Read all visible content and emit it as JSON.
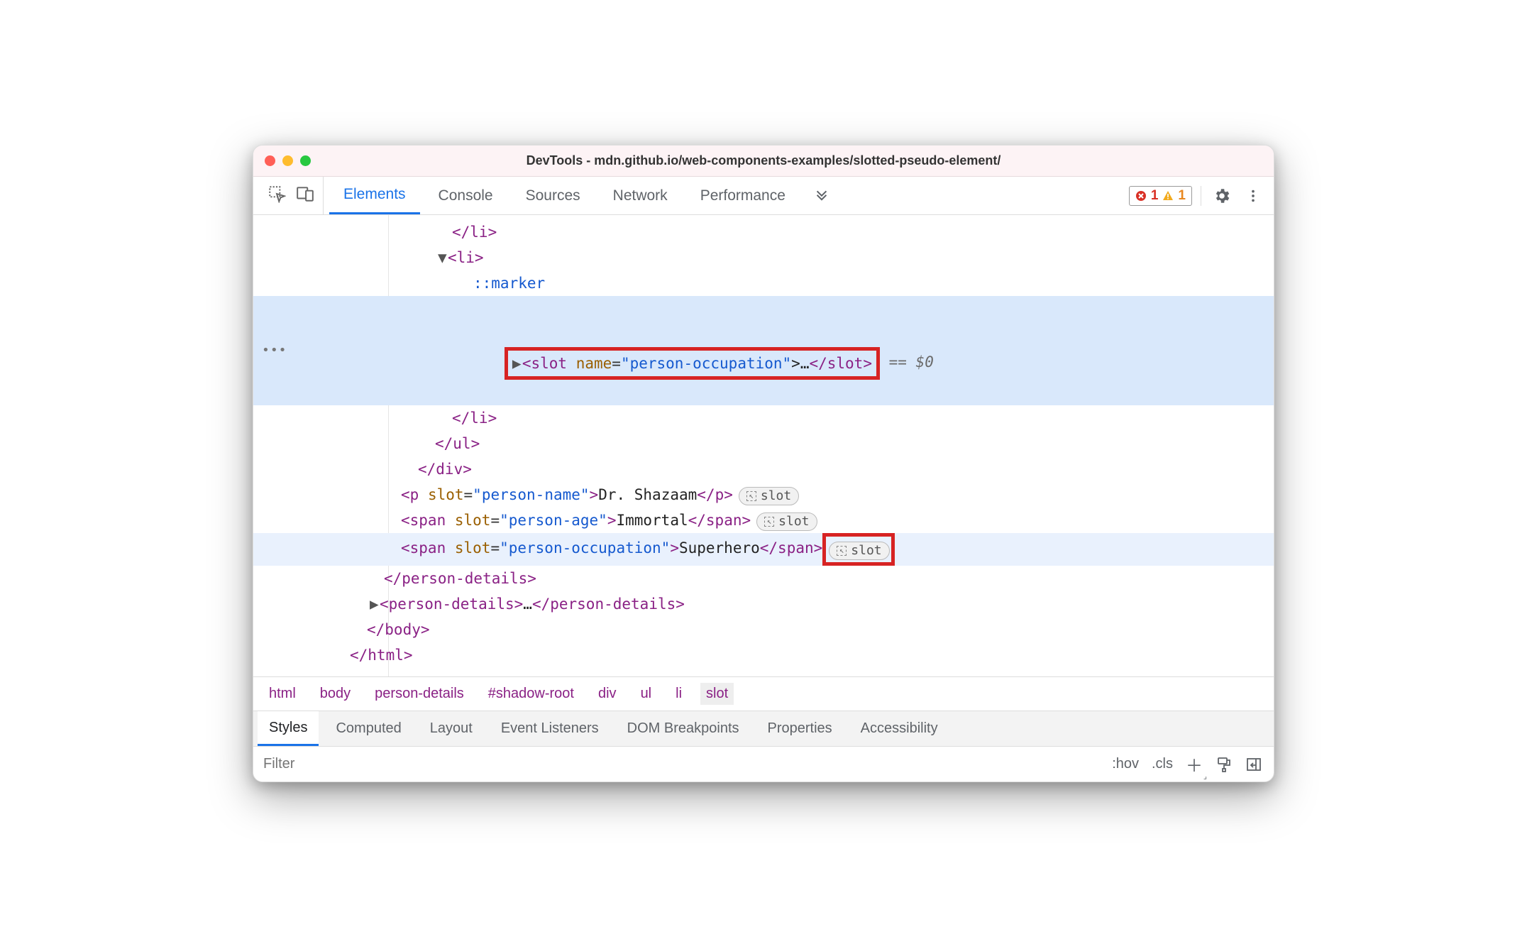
{
  "titlebar": {
    "title": "DevTools - mdn.github.io/web-components-examples/slotted-pseudo-element/"
  },
  "tabs": {
    "t0": "Elements",
    "t1": "Console",
    "t2": "Sources",
    "t3": "Network",
    "t4": "Performance"
  },
  "issues": {
    "errors": "1",
    "warnings": "1"
  },
  "dom": {
    "li_close_1": "</li>",
    "li_open": "<li>",
    "marker": "::marker",
    "slot_open_pre": "<slot ",
    "slot_name_attr": "name",
    "slot_name_val": "\"person-occupation\"",
    "slot_mid": ">…",
    "slot_close": "</slot>",
    "sel_suffix": " == $0",
    "li_close_2": "</li>",
    "ul_close": "</ul>",
    "div_close": "</div>",
    "p_open_pre": "<p ",
    "slot_attr": "slot",
    "p_slot_val": "\"person-name\"",
    "p_text": "Dr. Shazaam",
    "p_close": "</p>",
    "span1_val": "\"person-age\"",
    "span1_text": "Immortal",
    "span_open_pre": "<span ",
    "span_close": "</span>",
    "span2_val": "\"person-occupation\"",
    "span2_text": "Superhero",
    "pd_close": "</person-details>",
    "pd2_open": "<person-details>",
    "pd2_mid": "…",
    "pd2_close": "</person-details>",
    "body_close": "</body>",
    "html_close": "</html>",
    "slot_pill_label": "slot"
  },
  "crumb": {
    "c0": "html",
    "c1": "body",
    "c2": "person-details",
    "c3": "#shadow-root",
    "c4": "div",
    "c5": "ul",
    "c6": "li",
    "c7": "slot"
  },
  "subtabs": {
    "s0": "Styles",
    "s1": "Computed",
    "s2": "Layout",
    "s3": "Event Listeners",
    "s4": "DOM Breakpoints",
    "s5": "Properties",
    "s6": "Accessibility"
  },
  "filter": {
    "placeholder": "Filter",
    "hov": ":hov",
    "cls": ".cls"
  }
}
